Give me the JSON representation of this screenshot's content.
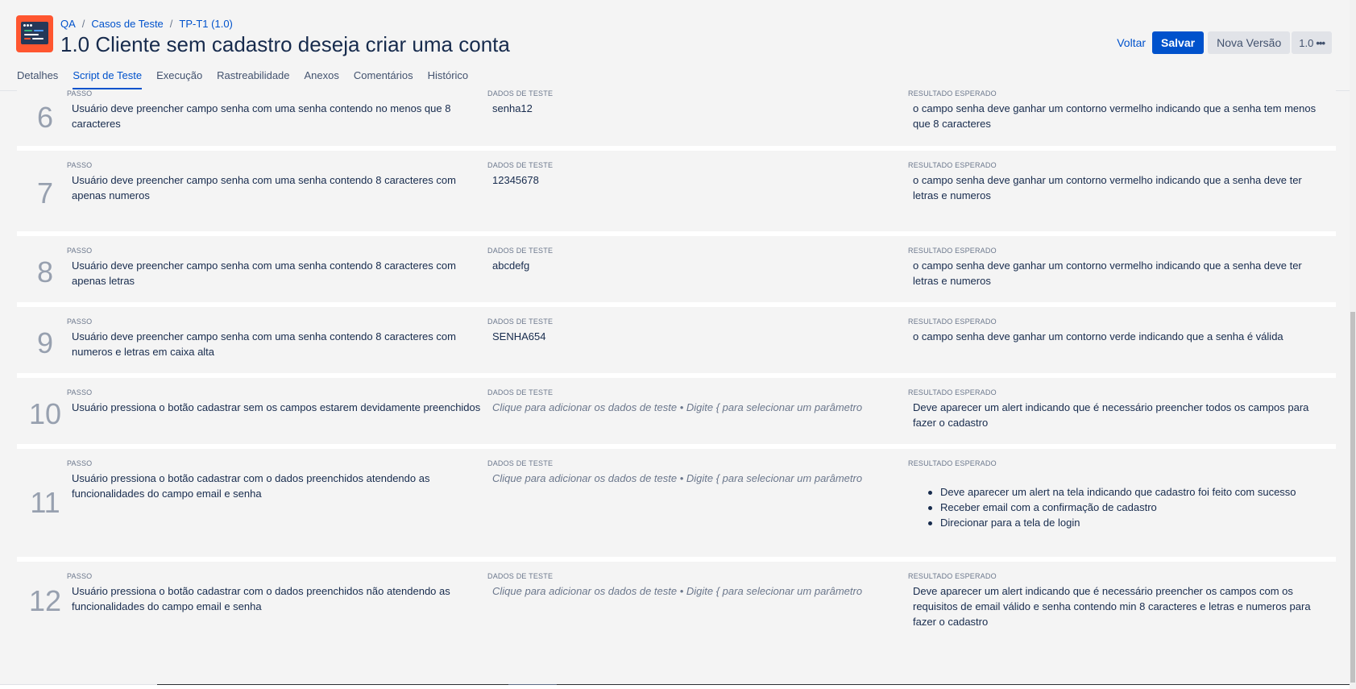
{
  "header": {
    "breadcrumb": [
      "QA",
      "Casos de Teste",
      "TP-T1 (1.0)"
    ],
    "breadcrumb_sep": "/",
    "title": "1.0 Cliente sem cadastro deseja criar uma conta",
    "actions": {
      "back_label": "Voltar",
      "save_label": "Salvar",
      "new_version_label": "Nova Versão",
      "version_label": "1.0",
      "more_label": "•••"
    }
  },
  "tabs": [
    {
      "label": "Detalhes",
      "active": false
    },
    {
      "label": "Script de Teste",
      "active": true
    },
    {
      "label": "Execução",
      "active": false
    },
    {
      "label": "Rastreabilidade",
      "active": false
    },
    {
      "label": "Anexos",
      "active": false
    },
    {
      "label": "Comentários",
      "active": false
    },
    {
      "label": "Histórico",
      "active": false
    }
  ],
  "columns": {
    "step": "PASSO",
    "data": "DADOS DE TESTE",
    "result": "RESULTADO ESPERADO"
  },
  "data_placeholder": "Clique para adicionar os dados de teste • Digite { para selecionar um parâmetro",
  "steps": [
    {
      "number": "6",
      "step": "Usuário deve preencher campo senha com uma senha contendo no menos que 8 caracteres",
      "data": "senha12",
      "result": "o campo senha deve ganhar um contorno vermelho indicando que a senha tem menos que 8 caracteres"
    },
    {
      "number": "7",
      "step": "Usuário deve preencher campo senha com uma senha contendo 8 caracteres com apenas numeros",
      "data": "12345678",
      "result": "o campo senha deve ganhar um contorno vermelho indicando que a senha deve ter letras e numeros"
    },
    {
      "number": "8",
      "step": "Usuário deve preencher campo senha com uma senha contendo 8 caracteres com apenas letras",
      "data": "abcdefg",
      "result": "o campo senha deve ganhar um contorno vermelho indicando que a senha deve ter letras e numeros"
    },
    {
      "number": "9",
      "step": "Usuário deve preencher campo senha com uma senha contendo 8 caracteres com numeros e letras em caixa alta",
      "data": "SENHA654",
      "result": "o campo senha deve ganhar um contorno verde indicando que a senha é válida"
    },
    {
      "number": "10",
      "step": "Usuário pressiona o botão cadastrar sem os campos estarem devidamente preenchidos",
      "data": "",
      "result": "Deve aparecer um alert indicando que é necessário preencher todos os campos para fazer o cadastro"
    },
    {
      "number": "11",
      "step": "Usuário pressiona o botão cadastrar com o dados preenchidos atendendo as funcionalidades do campo email e senha",
      "data": "",
      "result_items": [
        "Deve aparecer um alert na tela indicando que cadastro foi feito com sucesso",
        "Receber email com a confirmação de cadastro",
        "Direcionar para a tela de login"
      ]
    },
    {
      "number": "12",
      "step": "Usuário pressiona o botão cadastrar com o dados preenchidos não atendendo as funcionalidades do campo email e senha",
      "data": "",
      "result": "Deve aparecer um alert indicando que é necessário preencher  os campos com os requisitos de email válido e senha contendo min 8 caracteres e letras e numeros para fazer o cadastro"
    }
  ]
}
